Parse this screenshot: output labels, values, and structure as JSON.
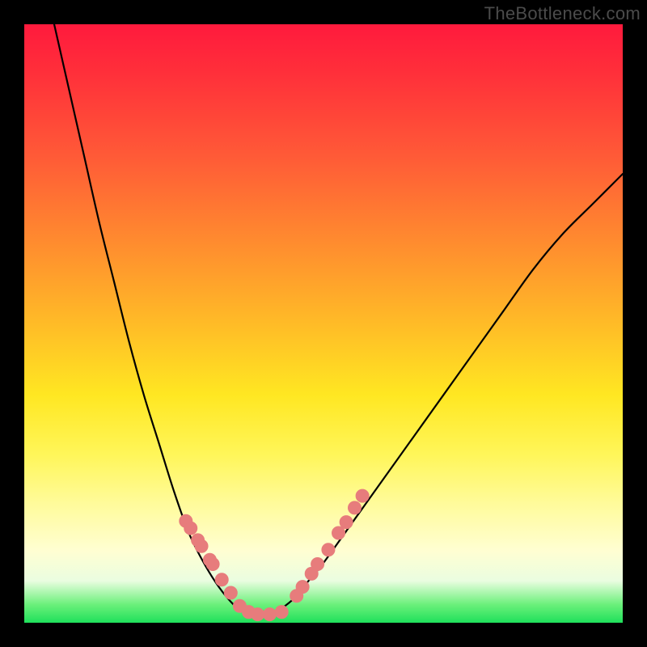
{
  "watermark": {
    "text": "TheBottleneck.com"
  },
  "colors": {
    "curve_stroke": "#000000",
    "marker_fill": "#e77c7c",
    "marker_stroke": "#e77c7c"
  },
  "chart_data": {
    "type": "line",
    "title": "",
    "xlabel": "",
    "ylabel": "",
    "xlim": [
      0,
      1
    ],
    "ylim": [
      0,
      1
    ],
    "x": [
      0.05,
      0.075,
      0.1,
      0.125,
      0.15,
      0.175,
      0.2,
      0.225,
      0.25,
      0.275,
      0.3,
      0.325,
      0.35,
      0.36,
      0.37,
      0.38,
      0.39,
      0.4,
      0.41,
      0.42,
      0.425,
      0.45,
      0.475,
      0.5,
      0.55,
      0.6,
      0.65,
      0.7,
      0.75,
      0.8,
      0.85,
      0.9,
      0.95,
      1.0
    ],
    "y": [
      1.0,
      0.89,
      0.78,
      0.67,
      0.57,
      0.47,
      0.38,
      0.3,
      0.22,
      0.15,
      0.1,
      0.06,
      0.03,
      0.025,
      0.02,
      0.018,
      0.016,
      0.015,
      0.015,
      0.016,
      0.02,
      0.04,
      0.07,
      0.1,
      0.17,
      0.24,
      0.31,
      0.38,
      0.45,
      0.52,
      0.59,
      0.65,
      0.7,
      0.75
    ],
    "markers_x": [
      0.27,
      0.278,
      0.29,
      0.296,
      0.31,
      0.315,
      0.33,
      0.345,
      0.36,
      0.375,
      0.39,
      0.41,
      0.43,
      0.455,
      0.465,
      0.48,
      0.49,
      0.508,
      0.525,
      0.538,
      0.552,
      0.565
    ],
    "markers_y": [
      0.17,
      0.158,
      0.138,
      0.128,
      0.105,
      0.098,
      0.072,
      0.05,
      0.028,
      0.018,
      0.014,
      0.014,
      0.018,
      0.045,
      0.06,
      0.082,
      0.098,
      0.122,
      0.15,
      0.168,
      0.192,
      0.212
    ],
    "marker_radius_px": 8
  }
}
